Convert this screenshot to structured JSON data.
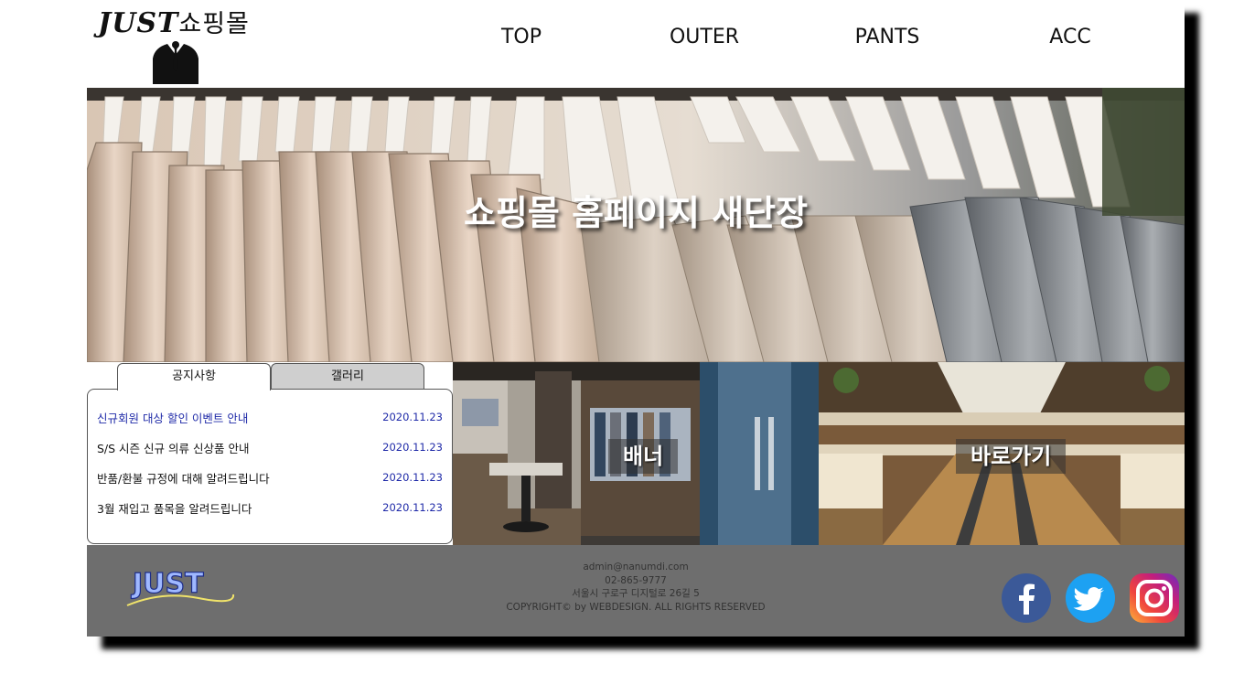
{
  "header": {
    "logo_latin": "JUST",
    "logo_korean": "쇼핑몰",
    "nav": [
      "TOP",
      "OUTER",
      "PANTS",
      "ACC"
    ]
  },
  "hero": {
    "title": "쇼핑몰 홈페이지 새단장"
  },
  "notice": {
    "tabs": [
      "공지사항",
      "갤러리"
    ],
    "items": [
      {
        "title": "신규회원 대상 할인 이벤트 안내",
        "date": "2020.11.23"
      },
      {
        "title": "S/S 시즌 신규 의류 신상품 안내",
        "date": "2020.11.23"
      },
      {
        "title": "반품/환불 규정에 대해 알려드립니다",
        "date": "2020.11.23"
      },
      {
        "title": "3월 재입고 품목을 알려드립니다",
        "date": "2020.11.23"
      }
    ]
  },
  "banners": [
    {
      "label": "배너"
    },
    {
      "label": "바로가기"
    }
  ],
  "footer": {
    "logo_text": "JUST",
    "email": "admin@nanumdi.com",
    "phone": "02-865-9777",
    "address": "서울시 구로구 디지털로 26길 5",
    "copyright": "COPYRIGHT© by WEBDESIGN. ALL RIGHTS RESERVED",
    "sns": [
      "facebook-icon",
      "twitter-icon",
      "instagram-icon"
    ]
  },
  "colors": {
    "footer_bg": "#6e6e6e",
    "notice_link": "#1f2aa8",
    "facebook": "#3b5998",
    "twitter": "#1da1f2"
  }
}
